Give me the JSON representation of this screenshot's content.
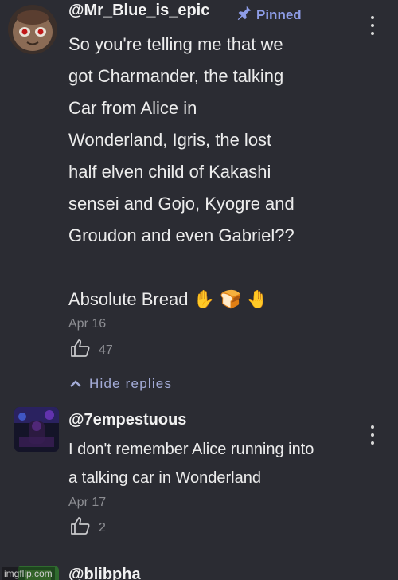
{
  "comments": [
    {
      "author": "@Mr_Blue_is_epic",
      "pinned_label": "Pinned",
      "text": "So you're telling me that we\ngot Charmander, the talking\nCar from Alice in\nWonderland, Igris, the lost\nhalf elven child of Kakashi\nsensei and Gojo, Kyogre and\nGroudon and even Gabriel??\n\nAbsolute Bread ✋ 🍞 🤚",
      "date": "Apr 16",
      "likes": "47"
    },
    {
      "author": "@7empestuous",
      "text": "I don't remember Alice running into\na talking car in Wonderland",
      "date": "Apr 17",
      "likes": "2"
    },
    {
      "author": "@blibpha"
    }
  ],
  "replies_toggle": {
    "label": "Hide replies"
  },
  "watermark": "imgflip.com",
  "icons": {
    "pin": "pin-icon",
    "like": "thumbs-up-icon",
    "more": "vertical-ellipsis-icon",
    "collapse": "chevron-up-icon"
  },
  "colors": {
    "background": "#2b2c33",
    "pinned_accent": "#8e9de8",
    "replies_accent": "#a4acd8",
    "muted_text": "#8d8e93"
  }
}
